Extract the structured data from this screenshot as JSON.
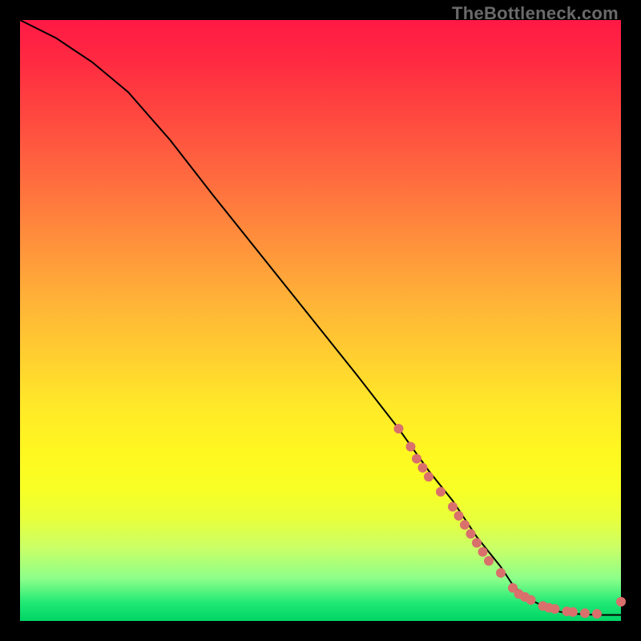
{
  "watermark": "TheBottleneck.com",
  "chart_data": {
    "type": "line",
    "title": "",
    "xlabel": "",
    "ylabel": "",
    "xlim": [
      0,
      100
    ],
    "ylim": [
      0,
      100
    ],
    "background": "heat-gradient-red-to-green-vertical",
    "series": [
      {
        "name": "curve",
        "color": "#000000",
        "x": [
          0,
          6,
          12,
          18,
          25,
          32,
          40,
          48,
          56,
          63,
          68,
          72,
          76,
          80,
          82,
          84,
          86,
          88,
          90,
          92,
          94,
          96,
          98,
          100
        ],
        "y": [
          100,
          97,
          93,
          88,
          80,
          71,
          61,
          51,
          41,
          32,
          25,
          20,
          14,
          9,
          6,
          4,
          3,
          2,
          1.5,
          1.2,
          1.1,
          1.0,
          1.0,
          1.0
        ]
      }
    ],
    "markers": [
      {
        "name": "dots",
        "color": "#d9706c",
        "radius": 6,
        "x": [
          63,
          65,
          66,
          67,
          68,
          70,
          72,
          73,
          74,
          75,
          76,
          77,
          78,
          80,
          82,
          83,
          84,
          85,
          87,
          88,
          89,
          91,
          92,
          94,
          96,
          100
        ],
        "y": [
          32,
          29,
          27,
          25.5,
          24,
          21.5,
          19,
          17.5,
          16,
          14.5,
          13,
          11.5,
          10,
          8,
          5.5,
          4.5,
          4,
          3.5,
          2.5,
          2.2,
          2.0,
          1.6,
          1.5,
          1.3,
          1.2,
          3.2
        ]
      }
    ]
  }
}
